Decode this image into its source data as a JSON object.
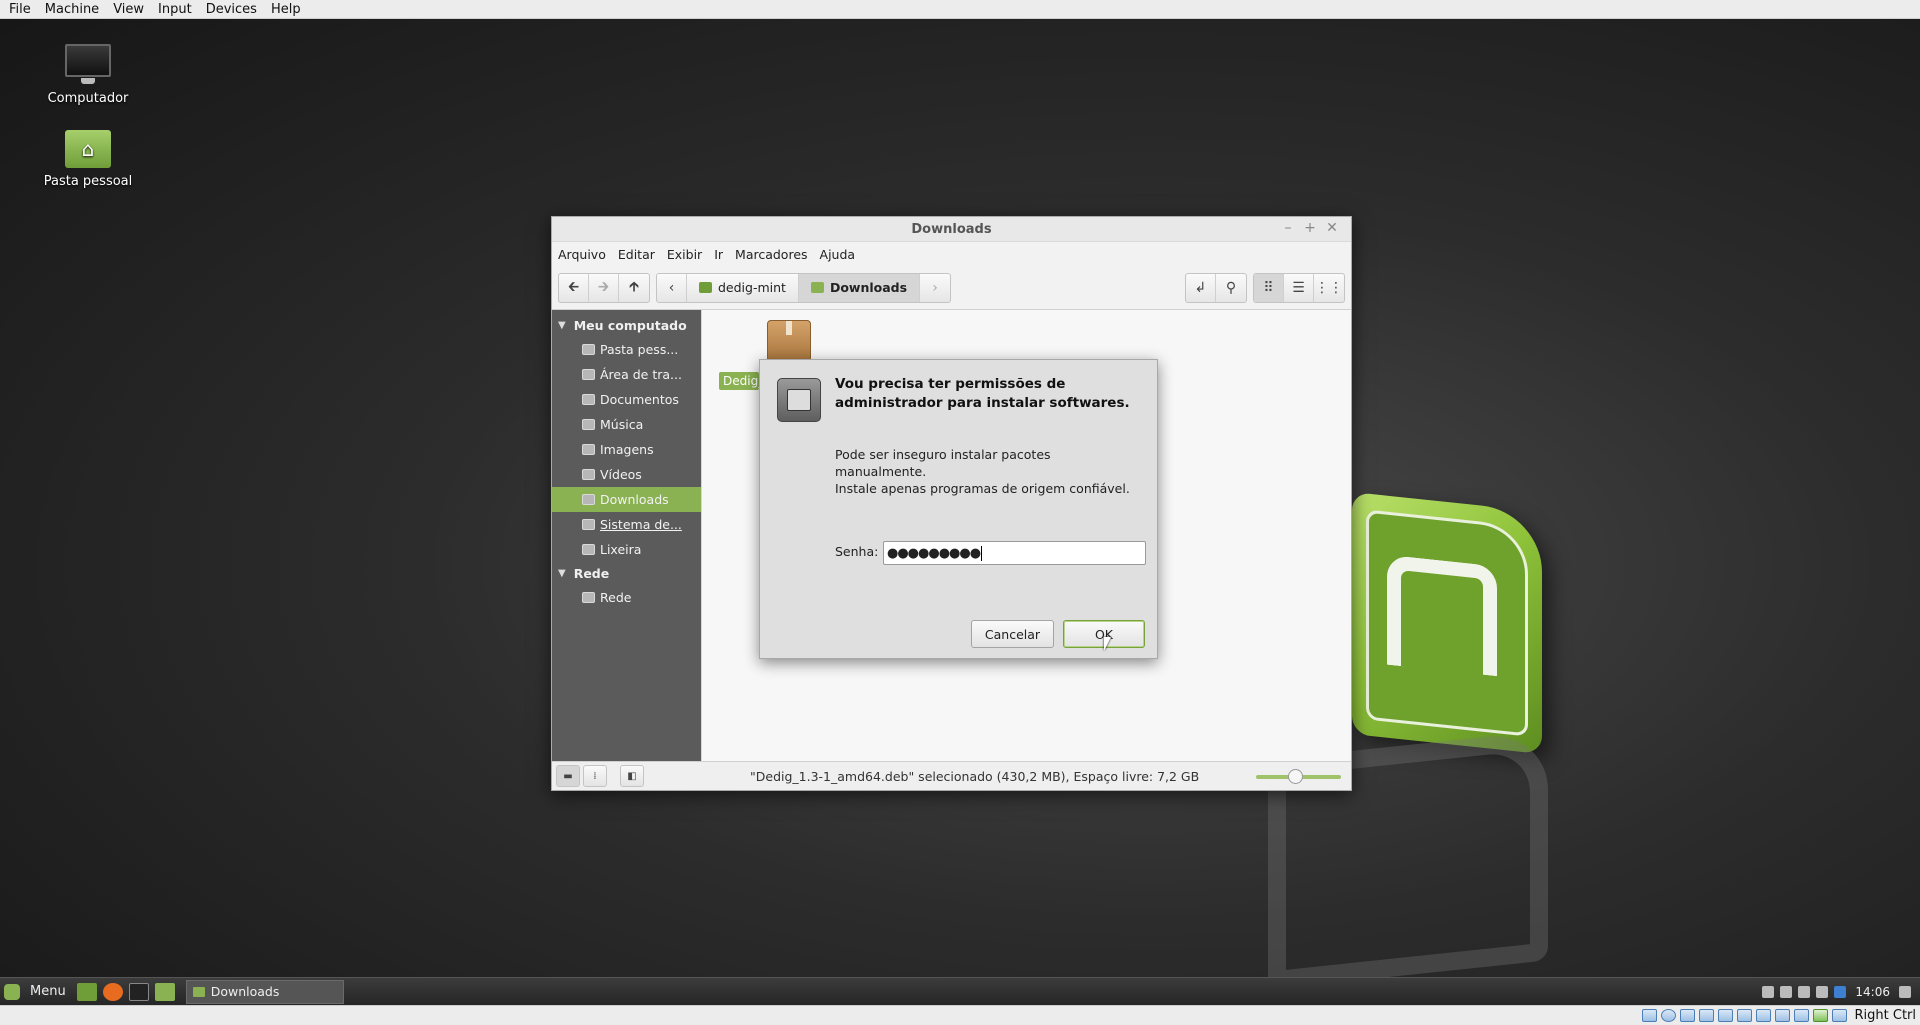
{
  "host_menu": [
    "File",
    "Machine",
    "View",
    "Input",
    "Devices",
    "Help"
  ],
  "host_status": {
    "hostkey": "Right Ctrl"
  },
  "desktop": {
    "icons": [
      {
        "label": "Computador",
        "icon": "computer-icon"
      },
      {
        "label": "Pasta pessoal",
        "icon": "home-folder-icon"
      }
    ]
  },
  "file_manager": {
    "title": "Downloads",
    "menu": [
      "Arquivo",
      "Editar",
      "Exibir",
      "Ir",
      "Marcadores",
      "Ajuda"
    ],
    "breadcrumbs": [
      "dedig-mint",
      "Downloads"
    ],
    "sidebar": {
      "sections": [
        {
          "title": "Meu computado",
          "items": [
            "Pasta pess...",
            "Área de tra...",
            "Documentos",
            "Música",
            "Imagens",
            "Vídeos",
            "Downloads",
            "Sistema de...",
            "Lixeira"
          ]
        },
        {
          "title": "Rede",
          "items": [
            "Rede"
          ]
        }
      ],
      "active_item": "Downloads"
    },
    "file_label": "Dedig_1.3-1_amd64.deb",
    "status_text": "\"Dedig_1.3-1_amd64.deb\" selecionado (430,2 MB), Espaço livre: 7,2 GB",
    "zoom_level": 0.45
  },
  "auth_dialog": {
    "heading": "Vou precisa ter permissões de administrador para instalar softwares.",
    "body_line1": "Pode ser inseguro instalar pacotes manualmente.",
    "body_line2": "Instale apenas programas de origem confiável.",
    "password_label": "Senha:",
    "password_value": "●●●●●●●●●",
    "cancel_label": "Cancelar",
    "ok_label": "OK"
  },
  "taskbar": {
    "menu_label": "Menu",
    "task_label": "Downloads",
    "clock": "14:06"
  },
  "colors": {
    "accent": "#8ab252",
    "sidebar_bg": "#5b5b5b"
  }
}
